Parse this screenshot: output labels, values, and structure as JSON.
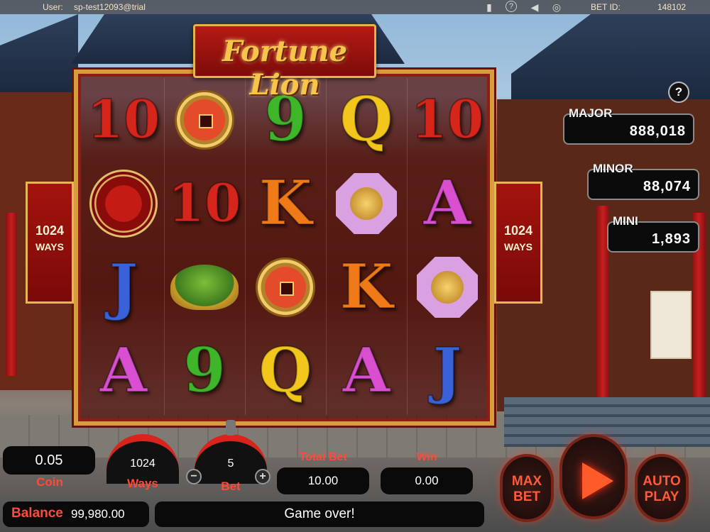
{
  "topbar": {
    "user_label": "User:",
    "user_value": "sp-test12093@trial",
    "bet_id_label": "BET ID:",
    "bet_id_value": "148102",
    "icons": [
      "book-icon",
      "help-icon",
      "sound-icon",
      "globe-icon"
    ]
  },
  "logo": {
    "title": "Fortune Lion"
  },
  "side_panels": {
    "ways_count": "1024",
    "ways_label": "WAYS"
  },
  "jackpots": [
    {
      "label": "MAJOR",
      "value": "888,018"
    },
    {
      "label": "MINOR",
      "value": "88,074"
    },
    {
      "label": "MINI",
      "value": "1,893"
    }
  ],
  "help_button": "?",
  "reels": [
    [
      "10",
      "medallion",
      "J",
      "A"
    ],
    [
      "coin",
      "10",
      "turtle",
      "9"
    ],
    [
      "9",
      "K",
      "coin",
      "Q"
    ],
    [
      "Q",
      "bagua",
      "K",
      "A"
    ],
    [
      "10",
      "A",
      "bagua",
      "J"
    ]
  ],
  "symbol_colors": {
    "10": "#d6261c",
    "9": "#3fb52a",
    "Q": "#f2c61a",
    "K": "#f07a18",
    "A": "#d94fd0",
    "J": "#3a62d8"
  },
  "controls": {
    "coin_value": "0.05",
    "coin_label": "Coin",
    "ways_value": "1024",
    "ways_label": "Ways",
    "bet_value": "5",
    "bet_label": "Bet",
    "bet_minus": "−",
    "bet_plus": "+",
    "total_bet_label": "Total Bet",
    "total_bet_value": "10.00",
    "win_label": "Win",
    "win_value": "0.00",
    "max_bet_label": "MAX BET",
    "auto_play_label": "AUTO PLAY",
    "balance_label": "Balance",
    "balance_value": "99,980.00",
    "message": "Game over!"
  },
  "colors": {
    "accent_red": "#ff4a3a",
    "frame_gold": "#d79c3b"
  }
}
